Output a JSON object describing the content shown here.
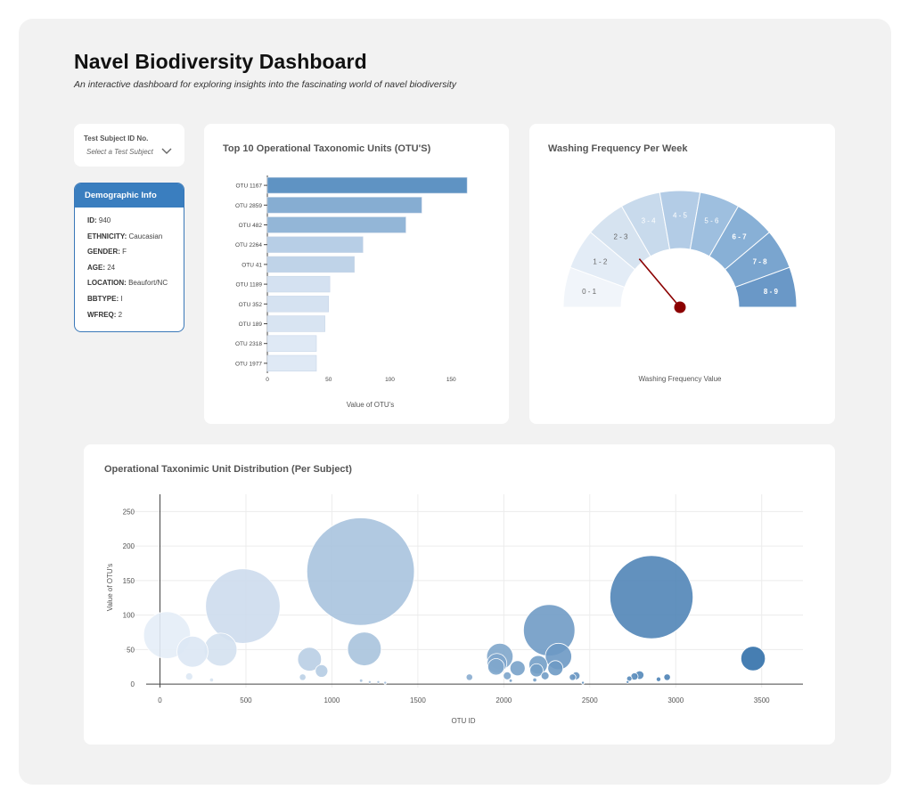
{
  "header": {
    "title": "Navel Biodiversity Dashboard",
    "subtitle": "An interactive dashboard for exploring insights into the fascinating world of navel biodiversity"
  },
  "selector": {
    "label": "Test Subject ID No.",
    "placeholder": "Select a Test Subject",
    "icon": "chevron-down-icon"
  },
  "demographics": {
    "title": "Demographic Info",
    "rows": [
      {
        "key": "ID:",
        "value": "940"
      },
      {
        "key": "ETHNICITY:",
        "value": "Caucasian"
      },
      {
        "key": "GENDER:",
        "value": "F"
      },
      {
        "key": "AGE:",
        "value": "24"
      },
      {
        "key": "LOCATION:",
        "value": "Beaufort/NC"
      },
      {
        "key": "BBTYPE:",
        "value": "I"
      },
      {
        "key": "WFREQ:",
        "value": "2"
      }
    ]
  },
  "chart_data": [
    {
      "type": "bar",
      "orientation": "horizontal",
      "title": "Top 10 Operational Taxonomic Units (OTU'S)",
      "xlabel": "Value of OTU's",
      "ylabel": "",
      "xlim": [
        0,
        168
      ],
      "xticks": [
        0,
        50,
        100,
        150
      ],
      "categories": [
        "OTU 1167",
        "OTU 2859",
        "OTU 482",
        "OTU 2264",
        "OTU 41",
        "OTU 1189",
        "OTU 352",
        "OTU 189",
        "OTU 2318",
        "OTU 1977"
      ],
      "values": [
        163,
        126,
        113,
        78,
        71,
        51,
        50,
        47,
        40,
        40
      ],
      "colorscale": [
        "#dfe9f5",
        "#5f93c3"
      ]
    },
    {
      "type": "gauge",
      "title": "Washing Frequency Per Week",
      "xlabel": "Washing Frequency Value",
      "range": [
        0,
        9
      ],
      "value": 2,
      "steps": [
        "0 - 1",
        "1 - 2",
        "2 - 3",
        "3 - 4",
        "4 - 5",
        "5 - 6",
        "6 - 7",
        "7 - 8",
        "8 - 9"
      ],
      "step_colors": [
        "#f1f5fa",
        "#e3ecf6",
        "#d6e3f0",
        "#c8daec",
        "#b3cce6",
        "#9ebfdf",
        "#88b0d6",
        "#7aa5cf",
        "#6a98c7"
      ],
      "needle_color": "#8b0000"
    },
    {
      "type": "scatter",
      "title": "Operational Taxonimic Unit Distribution (Per Subject)",
      "xlabel": "OTU ID",
      "ylabel": "Value of OTU's",
      "xlim": [
        -210,
        3740
      ],
      "ylim": [
        -5,
        275
      ],
      "xticks": [
        0,
        500,
        1000,
        1500,
        2000,
        2500,
        3000,
        3500
      ],
      "yticks": [
        0,
        50,
        100,
        150,
        200,
        250
      ],
      "colorscale": [
        "#e6eef8",
        "#2f6ea9"
      ],
      "points": [
        {
          "x": 41,
          "y": 71
        },
        {
          "x": 189,
          "y": 47
        },
        {
          "x": 352,
          "y": 50
        },
        {
          "x": 482,
          "y": 113
        },
        {
          "x": 1167,
          "y": 163
        },
        {
          "x": 1189,
          "y": 51
        },
        {
          "x": 870,
          "y": 36
        },
        {
          "x": 940,
          "y": 19
        },
        {
          "x": 2264,
          "y": 78
        },
        {
          "x": 2859,
          "y": 126
        },
        {
          "x": 3450,
          "y": 37
        },
        {
          "x": 1977,
          "y": 40
        },
        {
          "x": 1960,
          "y": 30
        },
        {
          "x": 1955,
          "y": 25
        },
        {
          "x": 2080,
          "y": 23
        },
        {
          "x": 2200,
          "y": 28
        },
        {
          "x": 2318,
          "y": 40
        },
        {
          "x": 2300,
          "y": 23
        },
        {
          "x": 2190,
          "y": 20
        },
        {
          "x": 2020,
          "y": 12
        },
        {
          "x": 2240,
          "y": 12
        },
        {
          "x": 2420,
          "y": 12
        },
        {
          "x": 2400,
          "y": 10
        },
        {
          "x": 1800,
          "y": 10
        },
        {
          "x": 2760,
          "y": 11
        },
        {
          "x": 2790,
          "y": 13
        },
        {
          "x": 2950,
          "y": 10
        },
        {
          "x": 2730,
          "y": 8
        },
        {
          "x": 2900,
          "y": 7
        },
        {
          "x": 2180,
          "y": 6
        },
        {
          "x": 2040,
          "y": 5
        },
        {
          "x": 170,
          "y": 11
        },
        {
          "x": 830,
          "y": 10
        },
        {
          "x": 300,
          "y": 6
        },
        {
          "x": 1170,
          "y": 5
        },
        {
          "x": 1270,
          "y": 3
        },
        {
          "x": 1220,
          "y": 3
        },
        {
          "x": 1310,
          "y": 2
        },
        {
          "x": 2720,
          "y": 3
        },
        {
          "x": 2460,
          "y": 2
        }
      ]
    }
  ]
}
